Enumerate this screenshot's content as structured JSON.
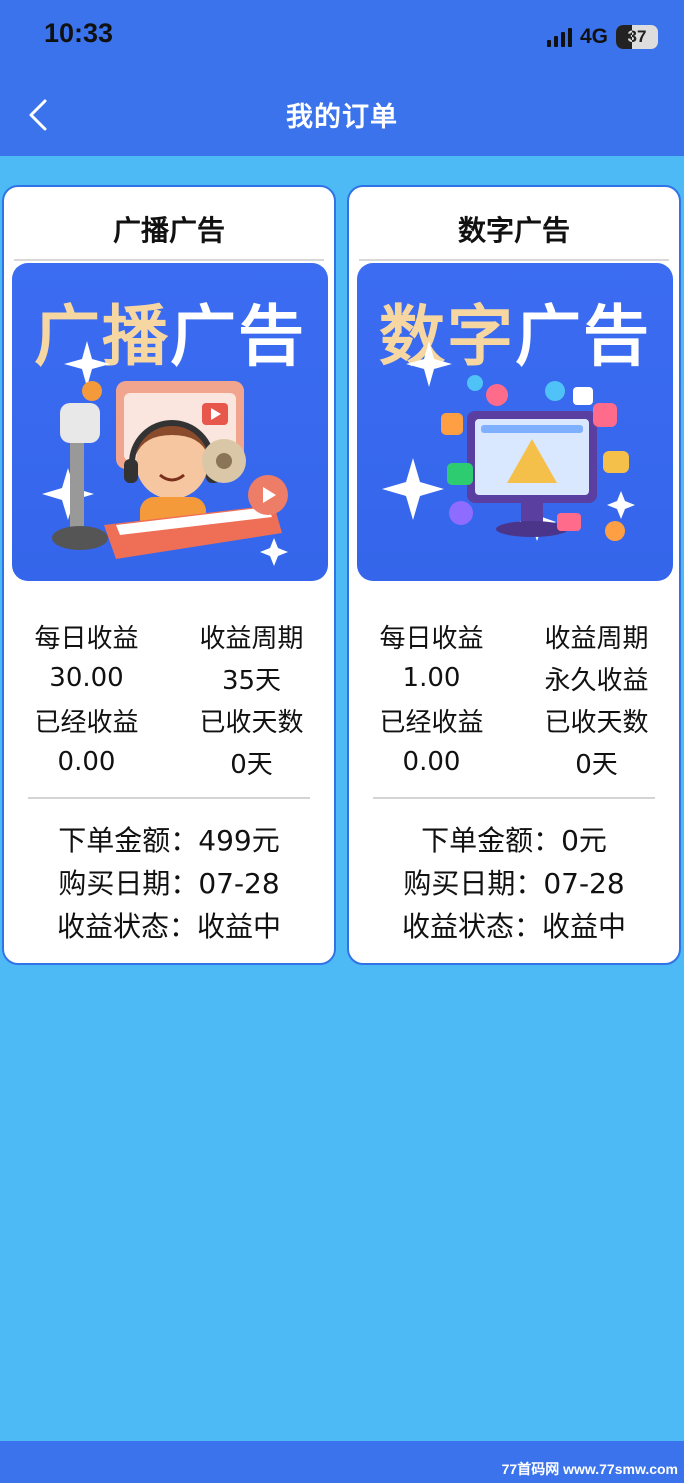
{
  "status_bar": {
    "time": "10:33",
    "network": "4G",
    "battery": "37"
  },
  "nav": {
    "title": "我的订单",
    "back_icon": "chevron-left-icon"
  },
  "orders": [
    {
      "title": "广播广告",
      "banner": {
        "text_part1": "广播",
        "text_part2": "广告"
      },
      "stats": {
        "daily_income_label": "每日收益",
        "cycle_label": "收益周期",
        "daily_income_value": "30.00",
        "cycle_value": "35天",
        "earned_label": "已经收益",
        "days_received_label": "已收天数",
        "earned_value": "0.00",
        "days_received_value": "0天"
      },
      "info": {
        "amount": "下单金额：499元",
        "date": "购买日期：07-28",
        "status": "收益状态：收益中"
      }
    },
    {
      "title": "数字广告",
      "banner": {
        "text_part1": "数字",
        "text_part2": "广告"
      },
      "stats": {
        "daily_income_label": "每日收益",
        "cycle_label": "收益周期",
        "daily_income_value": "1.00",
        "cycle_value": "永久收益",
        "earned_label": "已经收益",
        "days_received_label": "已收天数",
        "earned_value": "0.00",
        "days_received_value": "0天"
      },
      "info": {
        "amount": "下单金额：0元",
        "date": "购买日期：07-28",
        "status": "收益状态：收益中"
      }
    }
  ],
  "watermark": "77首码网 www.77smw.com",
  "colors": {
    "header": "#3a73ec",
    "page_background": "#4dbaf6",
    "card_border": "#2f73e7",
    "banner_background": "#3b6cf2",
    "banner_accent_text": "#f6d7a1"
  }
}
